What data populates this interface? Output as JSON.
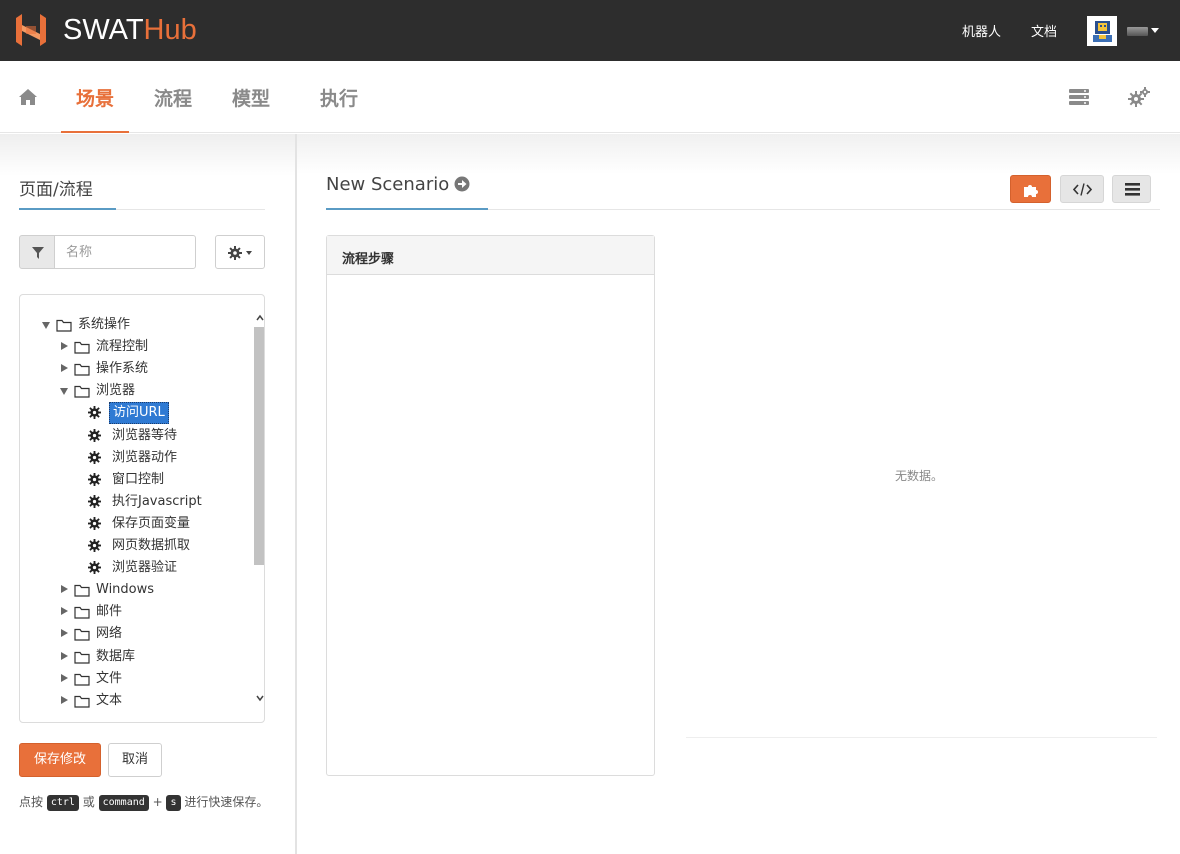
{
  "app": {
    "brand_swat": "SWAT",
    "brand_hub": "Hub",
    "accent_color": "#e8703a"
  },
  "topbar": {
    "links": [
      {
        "label": "机器人",
        "icon": "robot"
      },
      {
        "label": "文档",
        "icon": "docs"
      }
    ],
    "avatar_icon": "user-avatar-icon",
    "user_menu_icon": "caret-down-icon"
  },
  "nav": {
    "home_icon": "home-icon",
    "tabs": [
      {
        "label": "场景",
        "active": true
      },
      {
        "label": "流程",
        "active": false
      },
      {
        "label": "模型",
        "active": false
      },
      {
        "label": "执行",
        "active": false
      }
    ],
    "right_icons": [
      "server-icon",
      "cogs-icon"
    ]
  },
  "left": {
    "title": "页面/流程",
    "filter_placeholder": "名称",
    "filter_value": "",
    "tree": [
      {
        "label": "系统操作",
        "type": "folder",
        "expanded": true,
        "depth": 0
      },
      {
        "label": "流程控制",
        "type": "folder",
        "expanded": false,
        "depth": 1
      },
      {
        "label": "操作系统",
        "type": "folder",
        "expanded": false,
        "depth": 1
      },
      {
        "label": "浏览器",
        "type": "folder",
        "expanded": true,
        "depth": 1
      },
      {
        "label": "访问URL",
        "type": "action",
        "selected": true,
        "depth": 2
      },
      {
        "label": "浏览器等待",
        "type": "action",
        "depth": 2
      },
      {
        "label": "浏览器动作",
        "type": "action",
        "depth": 2
      },
      {
        "label": "窗口控制",
        "type": "action",
        "depth": 2
      },
      {
        "label": "执行Javascript",
        "type": "action",
        "depth": 2
      },
      {
        "label": "保存页面变量",
        "type": "action",
        "depth": 2
      },
      {
        "label": "网页数据抓取",
        "type": "action",
        "depth": 2
      },
      {
        "label": "浏览器验证",
        "type": "action",
        "depth": 2
      },
      {
        "label": "Windows",
        "type": "folder",
        "expanded": false,
        "depth": 1
      },
      {
        "label": "邮件",
        "type": "folder",
        "expanded": false,
        "depth": 1
      },
      {
        "label": "网络",
        "type": "folder",
        "expanded": false,
        "depth": 1
      },
      {
        "label": "数据库",
        "type": "folder",
        "expanded": false,
        "depth": 1
      },
      {
        "label": "文件",
        "type": "folder",
        "expanded": false,
        "depth": 1
      },
      {
        "label": "文本",
        "type": "folder",
        "expanded": false,
        "depth": 1
      }
    ],
    "save_label": "保存修改",
    "cancel_label": "取消",
    "hint": {
      "prefix": "点按",
      "key1": "ctrl",
      "or": "或",
      "key2": "command",
      "plus": "+",
      "key3": "s",
      "suffix": "进行快速保存。"
    }
  },
  "main": {
    "scenario_title": "New Scenario",
    "toolbar_icons": [
      "puzzle-icon",
      "code-icon",
      "list-icon"
    ],
    "steps_title": "流程步骤",
    "no_data": "无数据。"
  }
}
